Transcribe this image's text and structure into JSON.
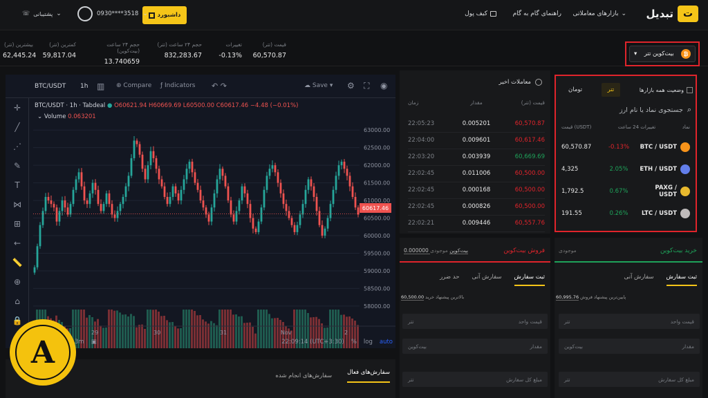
{
  "nav": {
    "logo_text": "تبدیل",
    "markets": "بازارهای معاملاتی",
    "guide": "راهنمای گام به گام",
    "wallet": "کیف پول",
    "dashboard": "داشبورد",
    "phone": "0930****3518",
    "support": "پشتیبانی"
  },
  "pair": {
    "name": "بیت‌کوین تتر",
    "icon": "bitcoin-icon"
  },
  "stats": [
    {
      "label": "قیمت (تتر)",
      "value": "60,570.87"
    },
    {
      "label": "تغییرات",
      "value": "-0.13%"
    },
    {
      "label": "حجم ۲۴ ساعت (تتر)",
      "value": "832,283.67"
    },
    {
      "label": "حجم ۲۴ ساعت (بیت‌کوین)",
      "value": "13.740659"
    },
    {
      "label": "کمترین (تتر)",
      "value": "59,817.04"
    },
    {
      "label": "بیشترین (تتر)",
      "value": "62,445.24"
    }
  ],
  "chart": {
    "symbol": "BTC/USDT",
    "interval": "1h",
    "compare": "Compare",
    "indicators": "Indicators",
    "save": "Save",
    "legend": "BTC/USDT · 1h · Tabdeal",
    "ohlc": "O60621.94 H60669.69 L60500.00 C60617.46 −4.48 (−0.01%)",
    "volume_label": "Volume",
    "volume_value": "0.063201",
    "last_price": "60617.46",
    "time": "22:09:14 (UTC+3:30)",
    "pct": "%",
    "log": "log",
    "auto": "auto",
    "range": "3m",
    "accent": "#26a69a",
    "down": "#ef5350"
  },
  "chart_data": {
    "type": "candlestick",
    "y_ticks": [
      "63000.00",
      "62500.00",
      "62000.00",
      "61500.00",
      "61000.00",
      "60500.00",
      "60000.00",
      "59500.00",
      "59000.00",
      "58500.00",
      "58000.00"
    ],
    "x_ticks": [
      "29",
      "30",
      "31",
      "Nov",
      "2"
    ],
    "ylim": [
      57900,
      63200
    ],
    "last": 60617.46,
    "closes": [
      59100,
      59700,
      60300,
      60700,
      61100,
      61000,
      60900,
      60800,
      60400,
      60700,
      61000,
      60800,
      60600,
      60900,
      61300,
      61600,
      61800,
      61400,
      61000,
      60900,
      61200,
      61500,
      61300,
      60900,
      60700,
      60900,
      61200,
      60900,
      60600,
      60500,
      60700,
      60900,
      61100,
      61400,
      61700,
      62200,
      62700,
      62600,
      62300,
      61900,
      61600,
      62000,
      62400,
      62200,
      61900,
      61600,
      61400,
      61100,
      60900,
      61100,
      61400,
      61200,
      61000,
      61300,
      61600,
      61900,
      62100,
      61800,
      61500,
      61300,
      61000,
      60800,
      60600,
      60400,
      60800,
      61200,
      61600,
      61900,
      61700,
      61400,
      61000,
      60600,
      60400,
      60700,
      61000,
      61400,
      61200,
      60900,
      60500,
      60200,
      60100,
      60400,
      60800,
      61300,
      61700,
      61900,
      62000,
      61800,
      61500,
      61200,
      60900,
      60700,
      60500,
      60300,
      60100,
      60300,
      60600,
      60900,
      61300,
      61600,
      61400,
      61100,
      60700,
      60300,
      60000,
      60200,
      60500,
      60900,
      61300,
      61700,
      62000,
      62100,
      61900,
      61700,
      61400,
      61100,
      60800,
      60600
    ]
  },
  "tools": [
    "crosshair-icon",
    "trendline-icon",
    "fib-icon",
    "brush-icon",
    "text-icon",
    "pattern-icon",
    "measure-icon",
    "arrow-icon",
    "ruler-icon",
    "zoom-icon",
    "magnet-icon",
    "lock-icon",
    "eye-icon"
  ],
  "market": {
    "tab_toman": "تومان",
    "tab_tether": "تتر",
    "tab_status": "وضعیت همه بازارها",
    "search_placeholder": "جستجوی نماد یا نام ارز",
    "col_symbol": "نماد",
    "col_change": "تغییرات 24 ساعت",
    "col_price": "قیمت (USDT)",
    "rows": [
      {
        "symbol": "BTC / USDT",
        "change": "-0.13%",
        "price": "60,570.87",
        "color": "#f7931a",
        "up": false
      },
      {
        "symbol": "ETH / USDT",
        "change": "2.05%",
        "price": "4,325",
        "color": "#627eea",
        "up": true
      },
      {
        "symbol": "PAXG / USDT",
        "change": "0.67%",
        "price": "1,792.5",
        "color": "#e8b92e",
        "up": true
      },
      {
        "symbol": "LTC / USDT",
        "change": "0.26%",
        "price": "191.55",
        "color": "#bfbbbb",
        "up": true
      }
    ]
  },
  "trades": {
    "title": "معاملات اخیر",
    "col_price": "قیمت (تتر)",
    "col_amount": "مقدار",
    "col_time": "زمان",
    "rows": [
      {
        "price": "60,570.87",
        "amount": "0.005201",
        "time": "22:05:23",
        "up": false
      },
      {
        "price": "60,617.46",
        "amount": "0.009601",
        "time": "22:04:00",
        "up": false
      },
      {
        "price": "60,669.69",
        "amount": "0.003939",
        "time": "22:03:20",
        "up": true
      },
      {
        "price": "60,500.00",
        "amount": "0.011006",
        "time": "22:02:45",
        "up": false
      },
      {
        "price": "60,500.00",
        "amount": "0.000168",
        "time": "22:02:45",
        "up": false
      },
      {
        "price": "60,500.00",
        "amount": "0.000826",
        "time": "22:02:45",
        "up": false
      },
      {
        "price": "60,557.76",
        "amount": "0.009446",
        "time": "22:02:21",
        "up": false
      }
    ]
  },
  "sell": {
    "title": "فروش بیت‌کوین",
    "balance_label": "موجودی",
    "balance": "0.000000 بیت‌کوین",
    "tab_limit": "ثبت سفارش",
    "tab_market": "سفارش آنی",
    "tab_stop": "حد ضرر",
    "best": "60,500.00",
    "best_label": "بالاترین پیشنهاد خرید",
    "unit_price": "قیمت واحد",
    "unit_price_cur": "تتر",
    "amount": "مقدار",
    "amount_cur": "بیت‌کوین",
    "total": "مبلغ کل سفارش",
    "total_cur": "تتر"
  },
  "buy": {
    "title": "خرید بیت‌کوین",
    "balance_label": "موجودی",
    "tab_limit": "ثبت سفارش",
    "tab_market": "سفارش آنی",
    "best": "60,995.76",
    "best_label": "پایین‌ترین پیشنهاد فروش",
    "unit_price": "قیمت واحد",
    "unit_price_cur": "تتر",
    "amount": "مقدار",
    "amount_cur": "بیت‌کوین",
    "total": "مبلغ کل سفارش",
    "total_cur": "تتر"
  },
  "orders": {
    "active": "سفارش‌های فعال",
    "done": "سفارش‌های انجام شده"
  },
  "watermark": "A"
}
